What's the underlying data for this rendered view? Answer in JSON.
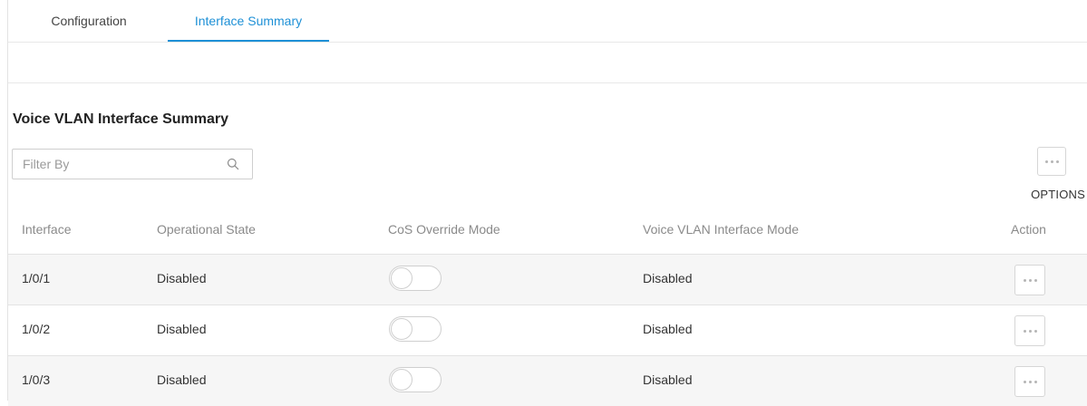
{
  "tabs": [
    {
      "label": "Configuration",
      "active": false
    },
    {
      "label": "Interface Summary",
      "active": true
    }
  ],
  "section": {
    "title": "Voice VLAN Interface Summary"
  },
  "filter": {
    "placeholder": "Filter By",
    "value": "",
    "icon": "search-icon"
  },
  "options": {
    "label": "OPTIONS",
    "icon": "more-horizontal-icon"
  },
  "table": {
    "columns": [
      "Interface",
      "Operational State",
      "CoS Override Mode",
      "Voice VLAN Interface Mode",
      "Action"
    ],
    "rows": [
      {
        "interface": "1/0/1",
        "operational_state": "Disabled",
        "cos_override": false,
        "voice_vlan_mode": "Disabled"
      },
      {
        "interface": "1/0/2",
        "operational_state": "Disabled",
        "cos_override": false,
        "voice_vlan_mode": "Disabled"
      },
      {
        "interface": "1/0/3",
        "operational_state": "Disabled",
        "cos_override": false,
        "voice_vlan_mode": "Disabled"
      }
    ]
  },
  "colors": {
    "accent": "#1e90d6",
    "row_shade": "#f6f6f6"
  }
}
